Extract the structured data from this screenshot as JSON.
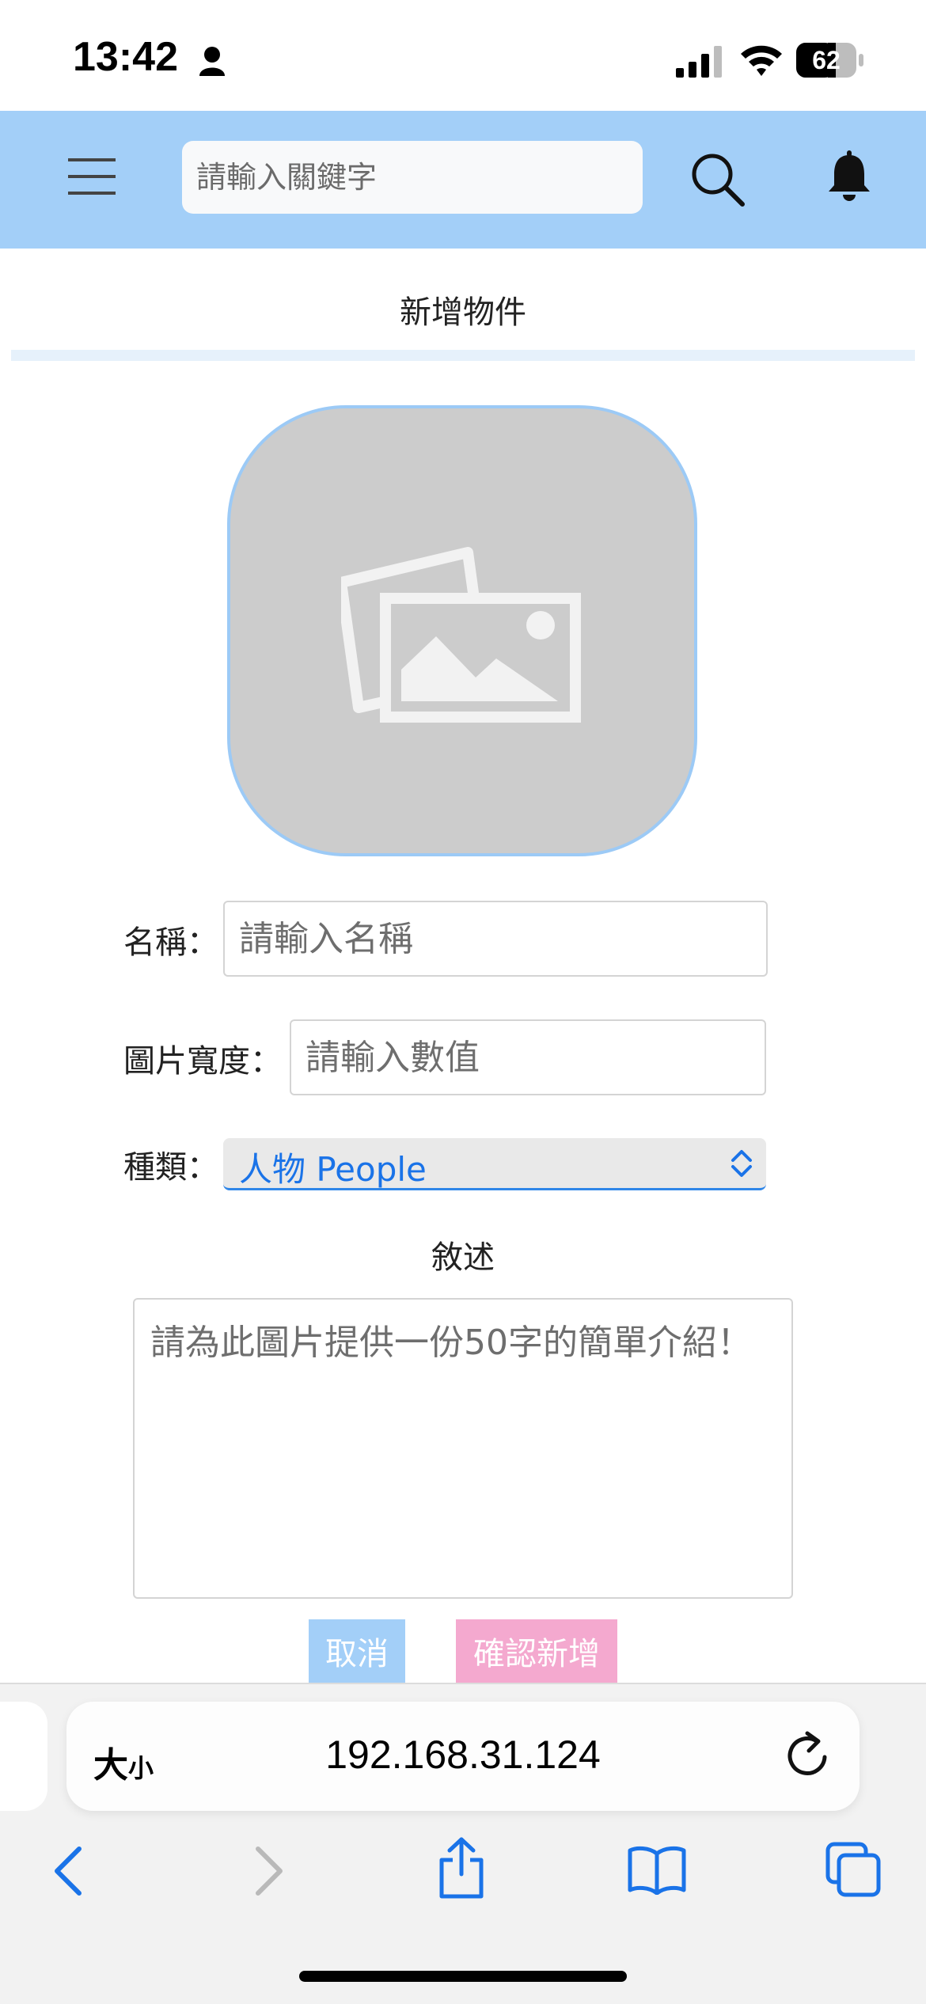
{
  "status_bar": {
    "time": "13:42",
    "battery": "62"
  },
  "header": {
    "search_placeholder": "請輸入關鍵字"
  },
  "page": {
    "title": "新增物件"
  },
  "form": {
    "name_label": "名稱：",
    "name_placeholder": "請輸入名稱",
    "width_label": "圖片寬度：",
    "width_placeholder": "請輸入數值",
    "type_label": "種類：",
    "type_selected": "人物 People",
    "description_label": "敘述",
    "description_placeholder": "請為此圖片提供一份50字的簡單介紹！",
    "cancel_label": "取消",
    "confirm_label": "確認新增"
  },
  "browser": {
    "text_size_big": "大",
    "text_size_small": "小",
    "url": "192.168.31.124"
  },
  "colors": {
    "header": "#a3cff8",
    "cancel": "#a3cff8",
    "confirm": "#f4a9cf",
    "accent": "#1a73e8"
  }
}
